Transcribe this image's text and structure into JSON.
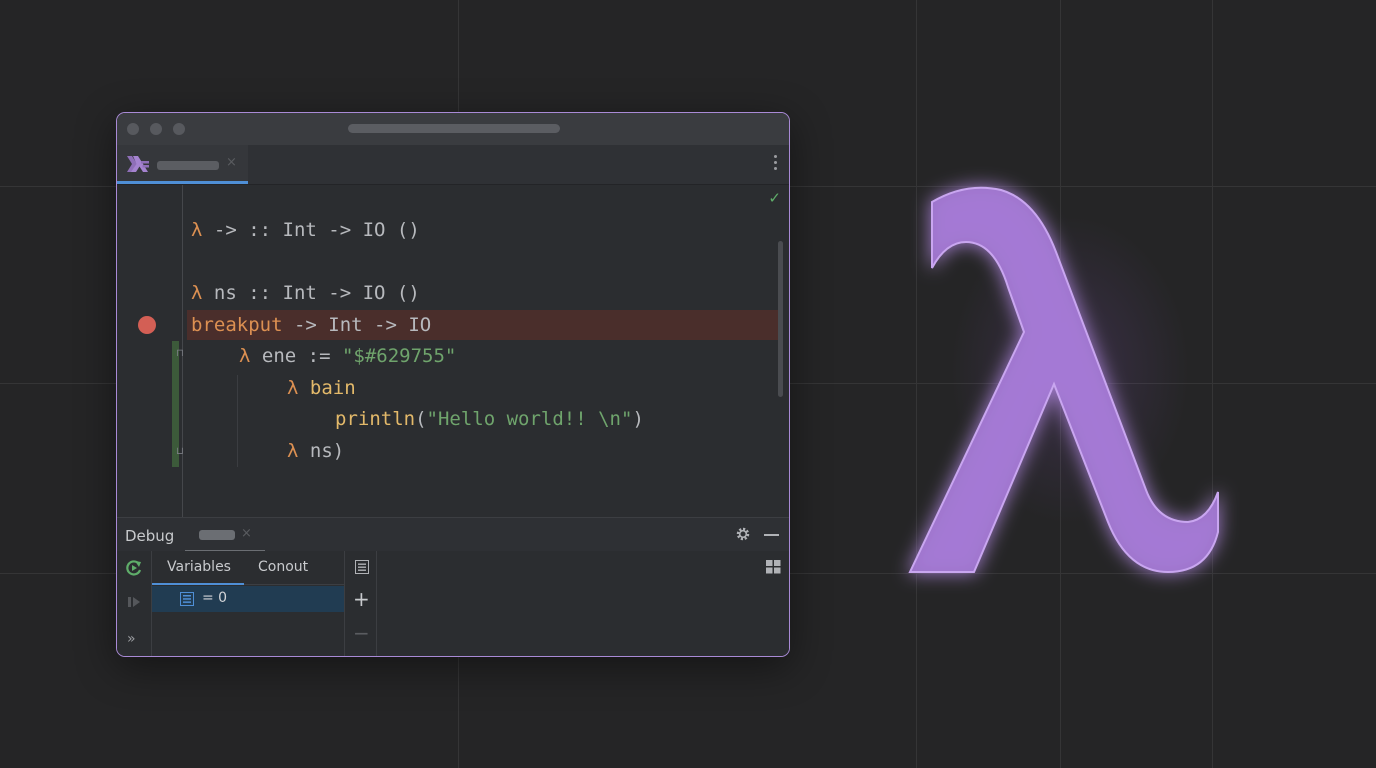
{
  "colors": {
    "background": "#252526",
    "window_border": "#a98ad6",
    "lambda": "#a57ad6",
    "breakpoint": "#d35f55",
    "keyword": "#dc9052",
    "string": "#6fa46c",
    "function": "#e3b96a",
    "selection": "#213c52",
    "accent": "#4f8fd6"
  },
  "editor": {
    "lines": [
      {
        "lambda": "λ",
        "text": " -> :: Int -> IO ()"
      },
      {
        "lambda": "λ",
        "text": " ns :: Int -> IO ()"
      },
      {
        "name": "breakput",
        "text": " -> Int -> IO"
      },
      {
        "lambda": "λ",
        "name": " ene",
        "op": " := ",
        "string": "\"$#629755\""
      },
      {
        "lambda": "λ",
        "name": " bain"
      },
      {
        "func": "println",
        "open": "(",
        "string": "\"Hello world!! \\n\"",
        "close": ")"
      },
      {
        "lambda": "λ",
        "text": " ns)"
      }
    ],
    "breakpoint_line": 3,
    "status_icon": "check-icon",
    "tab_close": "×"
  },
  "debug": {
    "title": "Debug",
    "tab_close": "×",
    "subtabs": [
      "Variables",
      "Conout"
    ],
    "variable_row": "= 0",
    "plus": "+",
    "minus": "−",
    "more": "»",
    "check": "✓"
  },
  "icons": [
    "haskell-icon",
    "kebab-menu-icon",
    "gear-icon",
    "minimize-icon",
    "resume-icon",
    "pause-icon",
    "list-icon",
    "layout-icon",
    "lambda-icon"
  ]
}
